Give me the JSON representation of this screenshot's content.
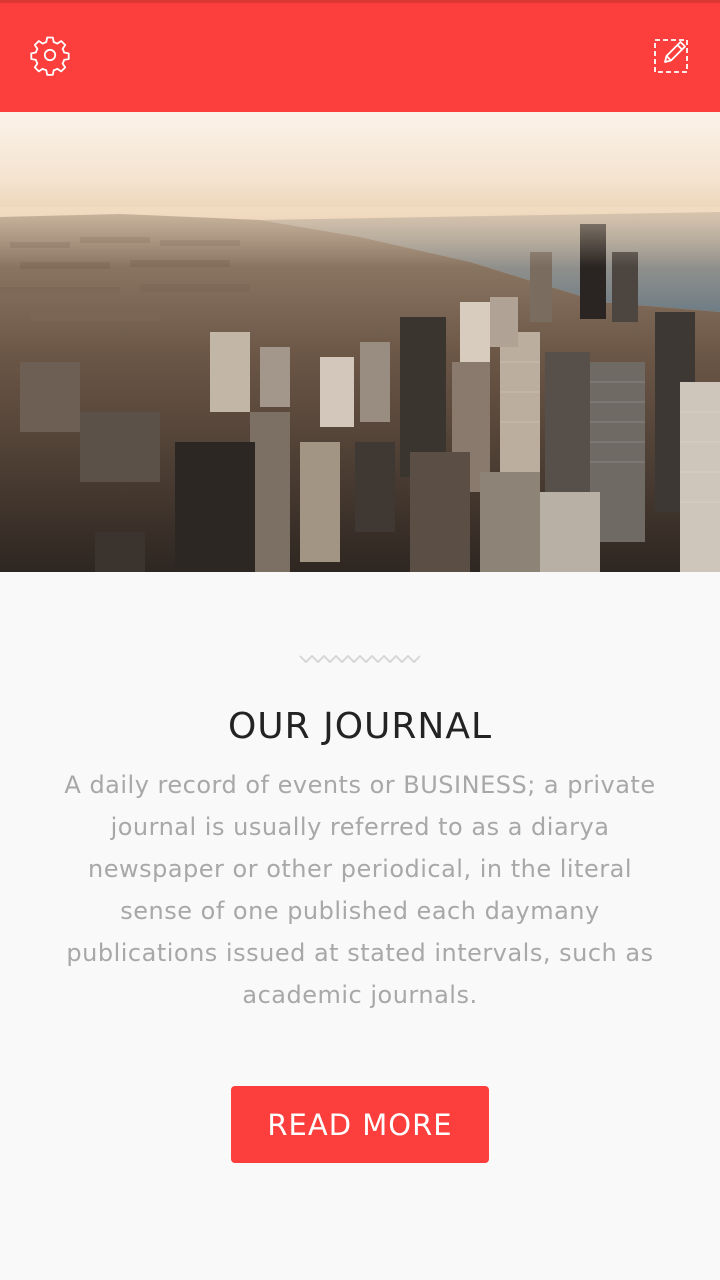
{
  "header": {
    "settings_icon": "gear-icon",
    "edit_icon": "edit-icon"
  },
  "colors": {
    "accent": "#fc3f3c",
    "background": "#f9f9f9",
    "title": "#232323",
    "body_text": "#a8a8a8"
  },
  "hero": {
    "image": "city-skyline-aerial-photo"
  },
  "content": {
    "divider_icon": "wave-divider-icon",
    "title": "OUR JOURNAL",
    "description": "A daily record of events or BUSINESS; a private journal is usually referred to as a diarya newspaper or other periodical, in the literal sense of one published each daymany publications issued at stated intervals, such as academic journals.",
    "button_label": "READ MORE"
  }
}
